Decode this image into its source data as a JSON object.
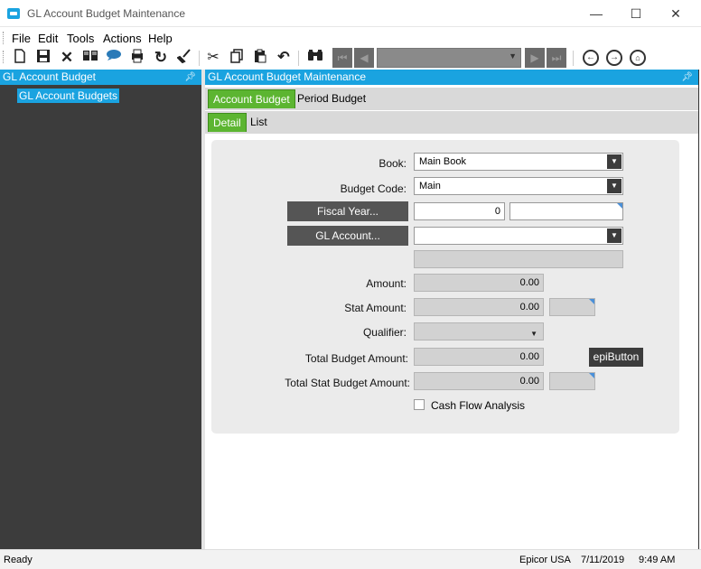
{
  "window": {
    "title": "GL Account Budget Maintenance",
    "min": "—",
    "max": "☐",
    "close": "✕"
  },
  "menu": [
    "File",
    "Edit",
    "Tools",
    "Actions",
    "Help"
  ],
  "toolbar": {
    "icons": [
      "new-icon",
      "save-icon",
      "delete-icon",
      "open-book-icon",
      "chat-icon",
      "print-icon",
      "refresh-icon",
      "clear-icon",
      "cut-icon",
      "copy-icon",
      "paste-icon",
      "undo-icon",
      "search-icon",
      "first-record-icon",
      "previous-record-icon",
      "record-selector",
      "next-record-icon",
      "last-record-icon",
      "back-icon",
      "forward-icon",
      "home-icon"
    ],
    "record_selector_value": ""
  },
  "left_panel": {
    "header": "GL Account Budget",
    "tree_item": "GL Account Budgets"
  },
  "right_panel": {
    "header": "GL Account Budget Maintenance",
    "tabs": [
      "Account Budget",
      "Period Budget"
    ],
    "subtabs": [
      "Detail",
      "List"
    ]
  },
  "form": {
    "book_label": "Book:",
    "book_value": "Main Book",
    "budget_code_label": "Budget Code:",
    "budget_code_value": "Main",
    "fiscal_year_button": "Fiscal Year...",
    "fiscal_year_value": "0",
    "fiscal_year_desc": "",
    "gl_account_button": "GL Account...",
    "gl_account_value": "",
    "gl_account_desc": "",
    "amount_label": "Amount:",
    "amount_value": "0.00",
    "stat_amount_label": "Stat Amount:",
    "stat_amount_value": "0.00",
    "stat_uom": "",
    "qualifier_label": "Qualifier:",
    "qualifier_value": "",
    "total_budget_label": "Total Budget Amount:",
    "total_budget_value": "0.00",
    "epi_button": "epiButton",
    "total_stat_label": "Total Stat Budget Amount:",
    "total_stat_value": "0.00",
    "total_stat_uom": "",
    "cash_flow_label": "Cash Flow Analysis",
    "cash_flow_checked": false
  },
  "status": {
    "state": "Ready",
    "company": "Epicor USA",
    "date": "7/11/2019",
    "time": "9:49 AM"
  },
  "colors": {
    "accent": "#1aa3e0",
    "tab_active": "#5cb531",
    "panel_dark": "#3c3c3c"
  }
}
